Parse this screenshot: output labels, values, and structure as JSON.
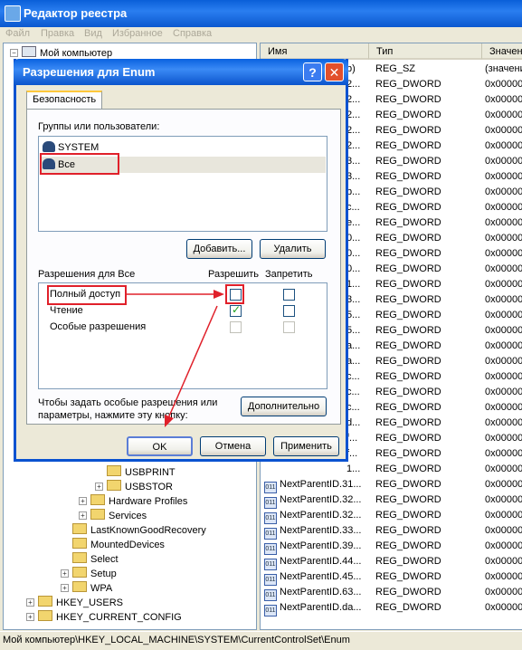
{
  "window": {
    "title": "Редактор реестра"
  },
  "menu": [
    "Файл",
    "Правка",
    "Вид",
    "Избранное",
    "Справка"
  ],
  "tree": {
    "root": "Мой компьютер",
    "items": [
      {
        "label": "USBPRINT",
        "level": 4,
        "expander": ""
      },
      {
        "label": "USBSTOR",
        "level": 4,
        "expander": "+"
      },
      {
        "label": "Hardware Profiles",
        "level": 3,
        "expander": "+"
      },
      {
        "label": "Services",
        "level": 3,
        "expander": "+"
      },
      {
        "label": "LastKnownGoodRecovery",
        "level": 2,
        "expander": ""
      },
      {
        "label": "MountedDevices",
        "level": 2,
        "expander": ""
      },
      {
        "label": "Select",
        "level": 2,
        "expander": ""
      },
      {
        "label": "Setup",
        "level": 2,
        "expander": "+"
      },
      {
        "label": "WPA",
        "level": 2,
        "expander": "+"
      },
      {
        "label": "HKEY_USERS",
        "level": 1,
        "expander": "+"
      },
      {
        "label": "HKEY_CURRENT_CONFIG",
        "level": 1,
        "expander": "+"
      }
    ]
  },
  "list": {
    "headers": {
      "name": "Имя",
      "type": "Тип",
      "value": "Значени"
    },
    "rows": [
      {
        "name": "b)",
        "type": "REG_SZ",
        "value": "(значени"
      },
      {
        "name": "2...",
        "type": "REG_DWORD",
        "value": "0x00000"
      },
      {
        "name": "2...",
        "type": "REG_DWORD",
        "value": "0x00000"
      },
      {
        "name": "2...",
        "type": "REG_DWORD",
        "value": "0x00000"
      },
      {
        "name": "2...",
        "type": "REG_DWORD",
        "value": "0x00000"
      },
      {
        "name": "2...",
        "type": "REG_DWORD",
        "value": "0x00000"
      },
      {
        "name": "3...",
        "type": "REG_DWORD",
        "value": "0x00000"
      },
      {
        "name": "3...",
        "type": "REG_DWORD",
        "value": "0x00000"
      },
      {
        "name": "b...",
        "type": "REG_DWORD",
        "value": "0x00000"
      },
      {
        "name": "c...",
        "type": "REG_DWORD",
        "value": "0x00000"
      },
      {
        "name": "e...",
        "type": "REG_DWORD",
        "value": "0x00000"
      },
      {
        "name": "0...",
        "type": "REG_DWORD",
        "value": "0x00000"
      },
      {
        "name": "0...",
        "type": "REG_DWORD",
        "value": "0x00000"
      },
      {
        "name": "0...",
        "type": "REG_DWORD",
        "value": "0x00000"
      },
      {
        "name": "1...",
        "type": "REG_DWORD",
        "value": "0x00000"
      },
      {
        "name": "3...",
        "type": "REG_DWORD",
        "value": "0x00000"
      },
      {
        "name": "5...",
        "type": "REG_DWORD",
        "value": "0x00000"
      },
      {
        "name": "5...",
        "type": "REG_DWORD",
        "value": "0x00000"
      },
      {
        "name": "a...",
        "type": "REG_DWORD",
        "value": "0x00000"
      },
      {
        "name": "a...",
        "type": "REG_DWORD",
        "value": "0x00000"
      },
      {
        "name": "c...",
        "type": "REG_DWORD",
        "value": "0x00000"
      },
      {
        "name": "c...",
        "type": "REG_DWORD",
        "value": "0x00000"
      },
      {
        "name": "c...",
        "type": "REG_DWORD",
        "value": "0x00000"
      },
      {
        "name": "d...",
        "type": "REG_DWORD",
        "value": "0x00000"
      },
      {
        "name": "f...",
        "type": "REG_DWORD",
        "value": "0x00000"
      },
      {
        "name": "f...",
        "type": "REG_DWORD",
        "value": "0x00000"
      },
      {
        "name": "1...",
        "type": "REG_DWORD",
        "value": "0x00000"
      },
      {
        "name": "NextParentID.31...",
        "type": "REG_DWORD",
        "value": "0x00000"
      },
      {
        "name": "NextParentID.32...",
        "type": "REG_DWORD",
        "value": "0x00000"
      },
      {
        "name": "NextParentID.32...",
        "type": "REG_DWORD",
        "value": "0x00000"
      },
      {
        "name": "NextParentID.33...",
        "type": "REG_DWORD",
        "value": "0x00000"
      },
      {
        "name": "NextParentID.39...",
        "type": "REG_DWORD",
        "value": "0x00000"
      },
      {
        "name": "NextParentID.44...",
        "type": "REG_DWORD",
        "value": "0x00000"
      },
      {
        "name": "NextParentID.45...",
        "type": "REG_DWORD",
        "value": "0x00000"
      },
      {
        "name": "NextParentID.63...",
        "type": "REG_DWORD",
        "value": "0x00000"
      },
      {
        "name": "NextParentID.da...",
        "type": "REG_DWORD",
        "value": "0x00000"
      }
    ]
  },
  "status": "Мой компьютер\\HKEY_LOCAL_MACHINE\\SYSTEM\\CurrentControlSet\\Enum",
  "dialog": {
    "title": "Разрешения для Enum",
    "help_btn": "?",
    "close_btn": "✕",
    "tab": "Безопасность",
    "groups_label": "Группы или пользователи:",
    "users": [
      "SYSTEM",
      "Все"
    ],
    "add_btn": "Добавить...",
    "remove_btn": "Удалить",
    "perm_label": "Разрешения для Все",
    "allow_label": "Разрешить",
    "deny_label": "Запретить",
    "perms": [
      {
        "label": "Полный доступ",
        "allow": false,
        "deny": false,
        "disabled": false
      },
      {
        "label": "Чтение",
        "allow": true,
        "deny": false,
        "disabled": false
      },
      {
        "label": "Особые разрешения",
        "allow": false,
        "deny": false,
        "disabled": true
      }
    ],
    "advanced_text": "Чтобы задать особые разрешения или параметры, нажмите эту кнопку:",
    "advanced_btn": "Дополнительно",
    "ok_btn": "OK",
    "cancel_btn": "Отмена",
    "apply_btn": "Применить"
  },
  "colors": {
    "xp_blue": "#0a52d0",
    "highlight": "#e0202a",
    "check": "#21a121"
  }
}
